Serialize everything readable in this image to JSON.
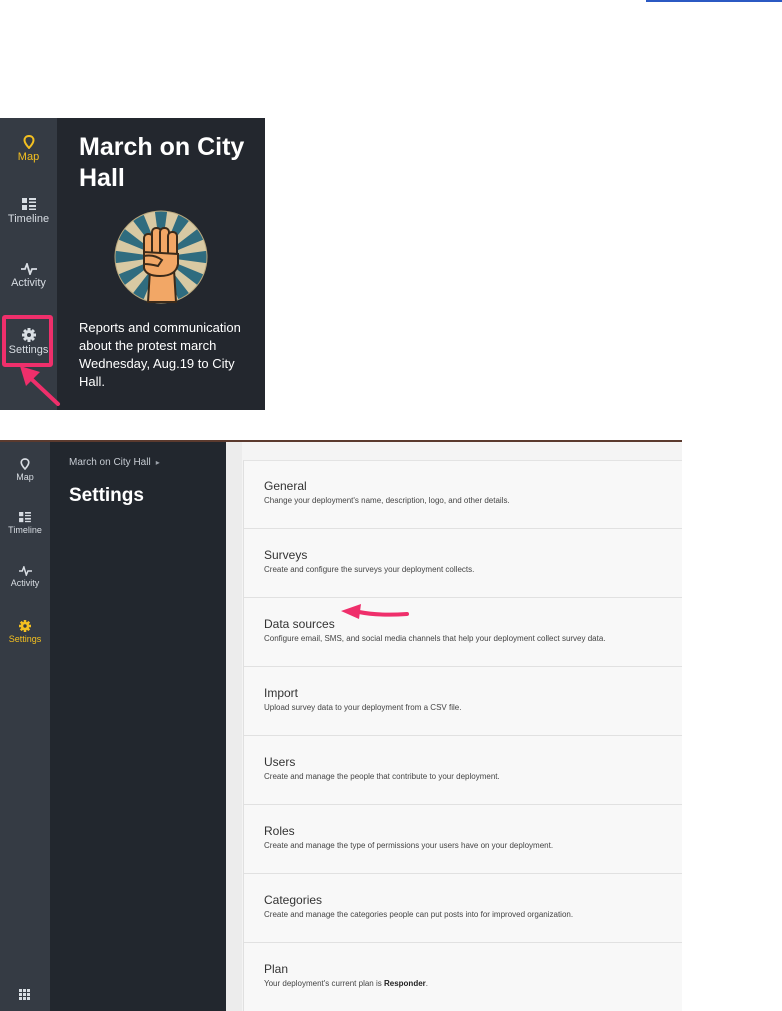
{
  "panel1": {
    "nav": [
      {
        "label": "Map",
        "icon": "map-marker-icon",
        "active": true
      },
      {
        "label": "Timeline",
        "icon": "timeline-icon"
      },
      {
        "label": "Activity",
        "icon": "activity-icon"
      },
      {
        "label": "Settings",
        "icon": "gear-icon"
      }
    ],
    "title": "March on City Hall",
    "description": "Reports and communication about the protest march Wednesday, Aug.19 to City Hall."
  },
  "panel2": {
    "nav": [
      {
        "label": "Map",
        "icon": "map-marker-icon"
      },
      {
        "label": "Timeline",
        "icon": "timeline-icon"
      },
      {
        "label": "Activity",
        "icon": "activity-icon"
      },
      {
        "label": "Settings",
        "icon": "gear-icon",
        "active": true
      }
    ],
    "breadcrumb": "March on City Hall",
    "heading": "Settings",
    "settings": [
      {
        "title": "General",
        "desc": "Change your deployment's name, description, logo, and other details."
      },
      {
        "title": "Surveys",
        "desc": "Create and configure the surveys your deployment collects."
      },
      {
        "title": "Data sources",
        "desc": "Configure email, SMS, and social media channels that help your deployment collect survey data."
      },
      {
        "title": "Import",
        "desc": "Upload survey data to your deployment from a CSV file."
      },
      {
        "title": "Users",
        "desc": "Create and manage the people that contribute to your deployment."
      },
      {
        "title": "Roles",
        "desc": "Create and manage the type of permissions your users have on your deployment."
      },
      {
        "title": "Categories",
        "desc": "Create and manage the categories people can put posts into for improved organization."
      },
      {
        "title": "Plan",
        "desc": "Your deployment's current plan is",
        "plan": "Responder",
        "desc_end": "."
      }
    ],
    "bottom_icon": "apps-grid-icon"
  },
  "colors": {
    "accent": "#f4c020",
    "highlight": "#ef2f6b",
    "rail": "#353b44",
    "sidebar": "#22272e"
  }
}
